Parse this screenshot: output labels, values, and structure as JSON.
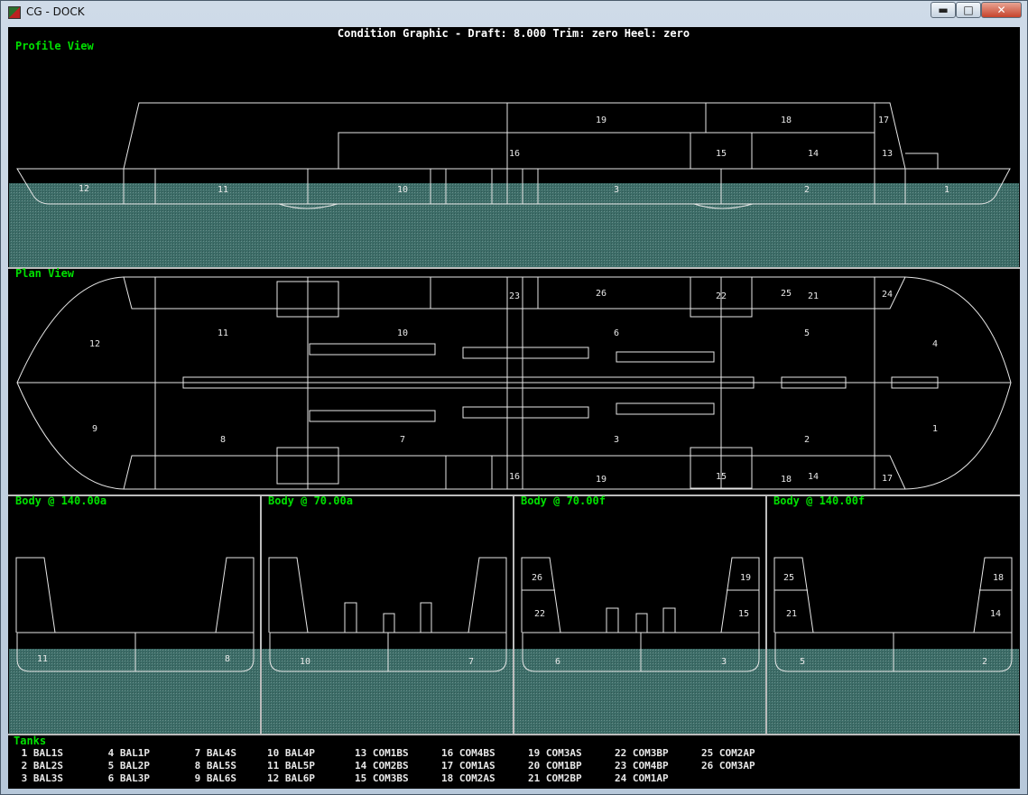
{
  "window": {
    "title": "CG - DOCK",
    "controls": {
      "minimize": "▬",
      "maximize": "□",
      "close": "✕"
    }
  },
  "graphic": {
    "header": "Condition Graphic - Draft: 8.000  Trim: zero  Heel: zero",
    "profile": {
      "label": "Profile View",
      "tank_numbers": [
        "19",
        "18",
        "17",
        "16",
        "15",
        "14",
        "13",
        "12",
        "11",
        "10",
        "3",
        "2",
        "1"
      ]
    },
    "plan": {
      "label": "Plan View",
      "tank_numbers": [
        "23",
        "26",
        "22",
        "25",
        "21",
        "24",
        "12",
        "11",
        "10",
        "6",
        "5",
        "4",
        "9",
        "8",
        "7",
        "3",
        "2",
        "1",
        "16",
        "19",
        "15",
        "18",
        "14",
        "17"
      ]
    },
    "body_sections": [
      {
        "label": "Body @ 140.00a",
        "tanks": [
          "11",
          "8"
        ]
      },
      {
        "label": "Body @ 70.00a",
        "tanks": [
          "10",
          "7"
        ]
      },
      {
        "label": "Body @ 70.00f",
        "tanks": [
          "26",
          "22",
          "6",
          "19",
          "15",
          "3"
        ]
      },
      {
        "label": "Body @ 140.00f",
        "tanks": [
          "25",
          "21",
          "5",
          "18",
          "14",
          "2"
        ]
      }
    ],
    "legend_title": "Tanks",
    "tanks": [
      " 1 BAL1S",
      " 2 BAL2S",
      " 3 BAL3S",
      " 4 BAL1P",
      " 5 BAL2P",
      " 6 BAL3P",
      " 7 BAL4S",
      " 8 BAL5S",
      " 9 BAL6S",
      "10 BAL4P",
      "11 BAL5P",
      "12 BAL6P",
      "13 COM1BS",
      "14 COM2BS",
      "15 COM3BS",
      "16 COM4BS",
      "17 COM1AS",
      "18 COM2AS",
      "19 COM3AS",
      "20 COM1BP",
      "21 COM2BP",
      "22 COM3BP",
      "23 COM4BP",
      "24 COM1AP",
      "25 COM2AP",
      "26 COM3AP"
    ]
  },
  "colors": {
    "label": "#00e000",
    "water": "#3d6d68",
    "lines": "#e6e6e6",
    "background": "#000000"
  }
}
